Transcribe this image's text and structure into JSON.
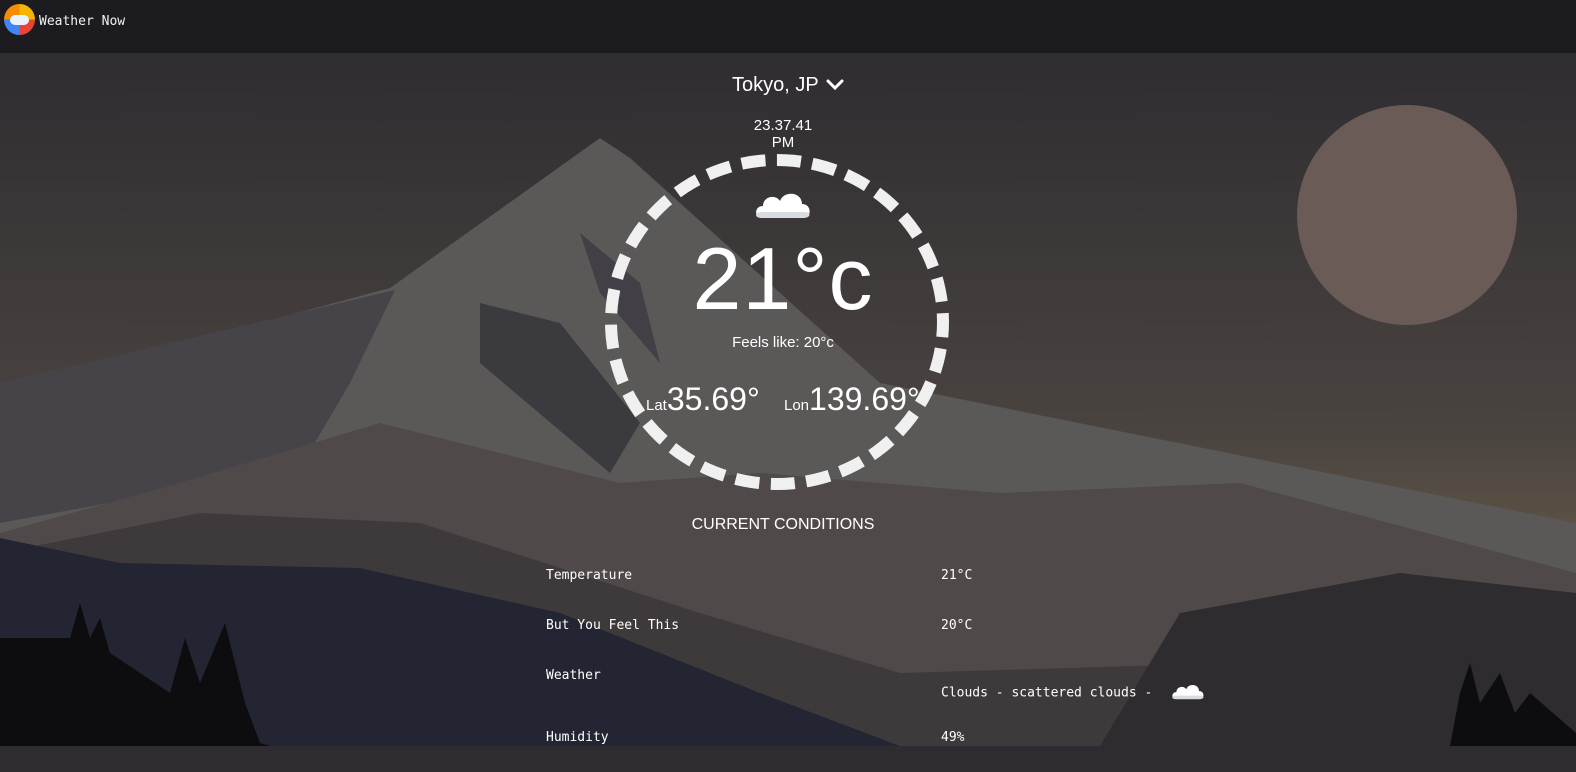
{
  "app": {
    "title": "Weather Now"
  },
  "location": {
    "label": "Tokyo, JP"
  },
  "clock": {
    "time": "23.37.41",
    "ampm": "PM"
  },
  "weather": {
    "temperature": "21°c",
    "feels_like": "Feels like: 20°c",
    "lat_label": "Lat",
    "lat_value": "35.69°",
    "lon_label": "Lon",
    "lon_value": "139.69°",
    "icon": "cloud-icon"
  },
  "conditions": {
    "title": "CURRENT CONDITIONS",
    "rows": [
      {
        "key": "Temperature",
        "value": "21°C"
      },
      {
        "key": "But You Feel This",
        "value": "20°C"
      },
      {
        "key": "Weather",
        "value": "Clouds - scattered clouds -"
      },
      {
        "key": "Humidity",
        "value": "49%"
      }
    ]
  },
  "colors": {
    "topbar": "#1c1c20",
    "ring": "#f0f0f0",
    "text": "#ffffff"
  }
}
